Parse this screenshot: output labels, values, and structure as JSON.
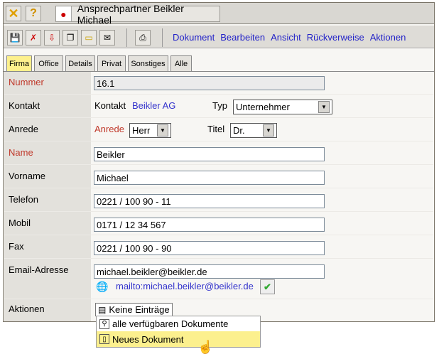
{
  "title": "Ansprechpartner Beikler Michael",
  "menu": [
    "Dokument",
    "Bearbeiten",
    "Ansicht",
    "Rückverweise",
    "Aktionen"
  ],
  "tabs": [
    "Firma",
    "Office",
    "Details",
    "Privat",
    "Sonstiges",
    "Alle"
  ],
  "fields": {
    "nummer": {
      "label": "Nummer",
      "value": "16.1"
    },
    "kontakt": {
      "label": "Kontakt",
      "inner_label": "Kontakt",
      "value": "Beikler AG",
      "typ_label": "Typ",
      "typ_value": "Unternehmer"
    },
    "anrede": {
      "label": "Anrede",
      "inner_label": "Anrede",
      "value": "Herr",
      "titel_label": "Titel",
      "titel_value": "Dr."
    },
    "name": {
      "label": "Name",
      "value": "Beikler"
    },
    "vorname": {
      "label": "Vorname",
      "value": "Michael"
    },
    "telefon": {
      "label": "Telefon",
      "value": "0221 / 100 90 - 11"
    },
    "mobil": {
      "label": "Mobil",
      "value": "0171 / 12 34 567"
    },
    "fax": {
      "label": "Fax",
      "value": "0221 / 100 90 - 90"
    },
    "email": {
      "label": "Email-Adresse",
      "value": "michael.beikler@beikler.de",
      "mailto": "mailto:michael.beikler@beikler.de"
    },
    "aktionen": {
      "label": "Aktionen",
      "button": "Keine Einträge"
    }
  },
  "dropdown": [
    "alle verfügbaren Dokumente",
    "Neues Dokument"
  ]
}
